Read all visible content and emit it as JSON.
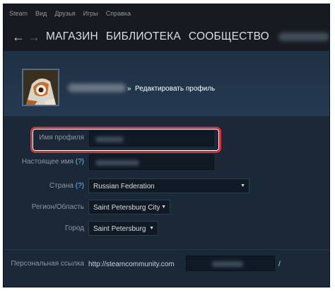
{
  "menubar": {
    "items": [
      "Steam",
      "Вид",
      "Друзья",
      "Игры",
      "Справка"
    ]
  },
  "navbar": {
    "back_icon": "←",
    "forward_icon": "→",
    "links": [
      "МАГАЗИН",
      "БИБЛИОТЕКА",
      "СООБЩЕСТВО"
    ]
  },
  "breadcrumb": {
    "separator": "»",
    "page": "Редактировать профиль"
  },
  "form": {
    "profile_name_label": "Имя профиля",
    "real_name_label": "Настоящее имя",
    "help_marker": "(?)",
    "country_label": "Страна",
    "country_value": "Russian Federation",
    "region_label": "Регион/Область",
    "region_value": "Saint Petersburg City",
    "city_label": "Город",
    "city_value": "Saint Petersburg",
    "custom_url_label": "Персональная ссылка",
    "custom_url_prefix": "http://steamcommunity.com",
    "custom_url_suffix": "/"
  },
  "colors": {
    "background": "#1b2838",
    "menubar": "#171a21",
    "link_accent": "#66c0f4",
    "highlight": "#d9303e"
  }
}
